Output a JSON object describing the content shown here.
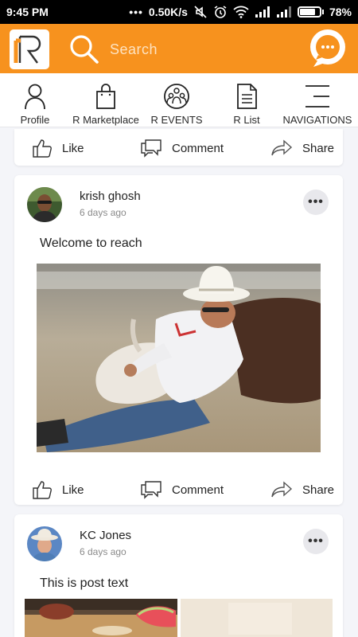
{
  "status_bar": {
    "time": "9:45 PM",
    "network_speed": "0.50K/s",
    "battery_percent": "78%",
    "battery_level": 0.78,
    "icons": [
      "more-dots-icon",
      "mute-icon",
      "alarm-icon",
      "wifi-icon",
      "signal-icon",
      "signal-icon",
      "battery-icon"
    ]
  },
  "header": {
    "logo_letter": "R",
    "search_placeholder": "Search",
    "brand_color": "#f7921e",
    "chat_icon": "chat-bubble-icon"
  },
  "nav": {
    "items": [
      {
        "label": "Profile",
        "icon": "person-icon"
      },
      {
        "label": "R Marketplace",
        "icon": "shopping-bag-icon"
      },
      {
        "label": "R EVENTS",
        "icon": "group-icon"
      },
      {
        "label": "R List",
        "icon": "document-icon"
      },
      {
        "label": "NAVIGATIONS",
        "icon": "menu-icon"
      }
    ]
  },
  "actions": {
    "like": "Like",
    "comment": "Comment",
    "share": "Share"
  },
  "posts": [
    {
      "author": "krish ghosh",
      "time": "6 days ago",
      "text": "Welcome to reach",
      "more": "•••",
      "image": "photo of a steer wrestler in a white cowboy hat and white shirt wrestling a steer in the dirt"
    },
    {
      "author": "KC Jones",
      "time": "6 days ago",
      "text": "This is post text",
      "more": "•••",
      "image": "two photos: food with a watermelon slice and a light beige image"
    }
  ]
}
